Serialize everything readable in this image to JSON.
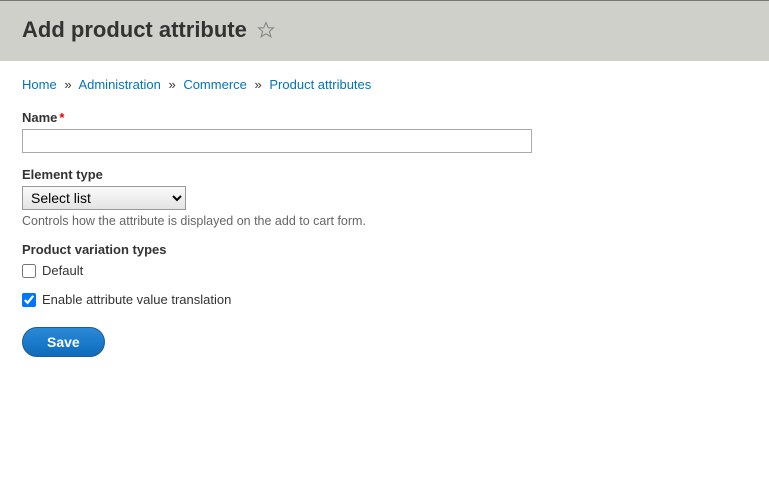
{
  "page_title": "Add product attribute",
  "breadcrumb": {
    "home": "Home",
    "administration": "Administration",
    "commerce": "Commerce",
    "product_attributes": "Product attributes",
    "separator": "»"
  },
  "form": {
    "name": {
      "label": "Name",
      "value": ""
    },
    "element_type": {
      "label": "Element type",
      "selected": "Select list",
      "description": "Controls how the attribute is displayed on the add to cart form."
    },
    "variation_types": {
      "label": "Product variation types",
      "options": {
        "default": {
          "label": "Default",
          "checked": false
        }
      }
    },
    "enable_translation": {
      "label": "Enable attribute value translation",
      "checked": true
    },
    "save_label": "Save"
  }
}
